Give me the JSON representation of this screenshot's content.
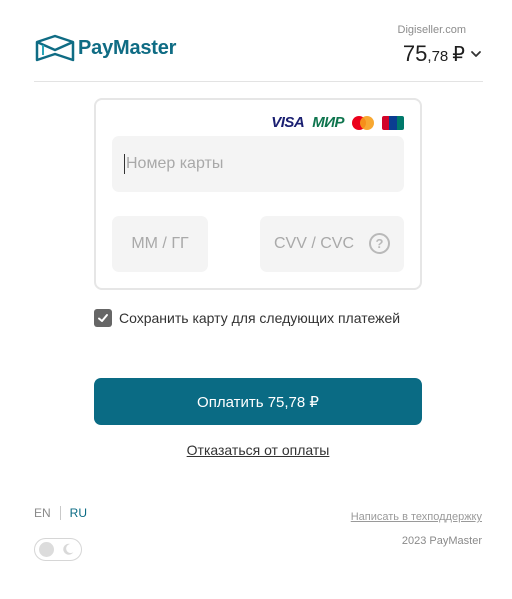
{
  "header": {
    "brand": "PayMaster",
    "merchant": "Digiseller.com",
    "amount_main": "75",
    "amount_decimal": ",78",
    "currency": "₽",
    "brand_color": "#0f6c84"
  },
  "card_form": {
    "card_logos": [
      "VISA",
      "МИР",
      "mastercard-icon",
      "unionpay-icon"
    ],
    "number_placeholder": "Номер карты",
    "expiry_placeholder": "ММ / ГГ",
    "cvv_placeholder": "CVV / CVC",
    "cvv_help": "?"
  },
  "save_card": {
    "checked": true,
    "label": "Сохранить карту для следующих платежей"
  },
  "actions": {
    "pay_label": "Оплатить 75,78 ₽",
    "cancel_label": "Отказаться от оплаты",
    "accent": "#0a6b84"
  },
  "footer": {
    "lang_en": "EN",
    "lang_ru": "RU",
    "support_link": "Написать в техподдержку",
    "copyright": "2023 PayMaster"
  },
  "theme_toggle": {
    "dark_mode": false,
    "icon": "moon-icon"
  }
}
